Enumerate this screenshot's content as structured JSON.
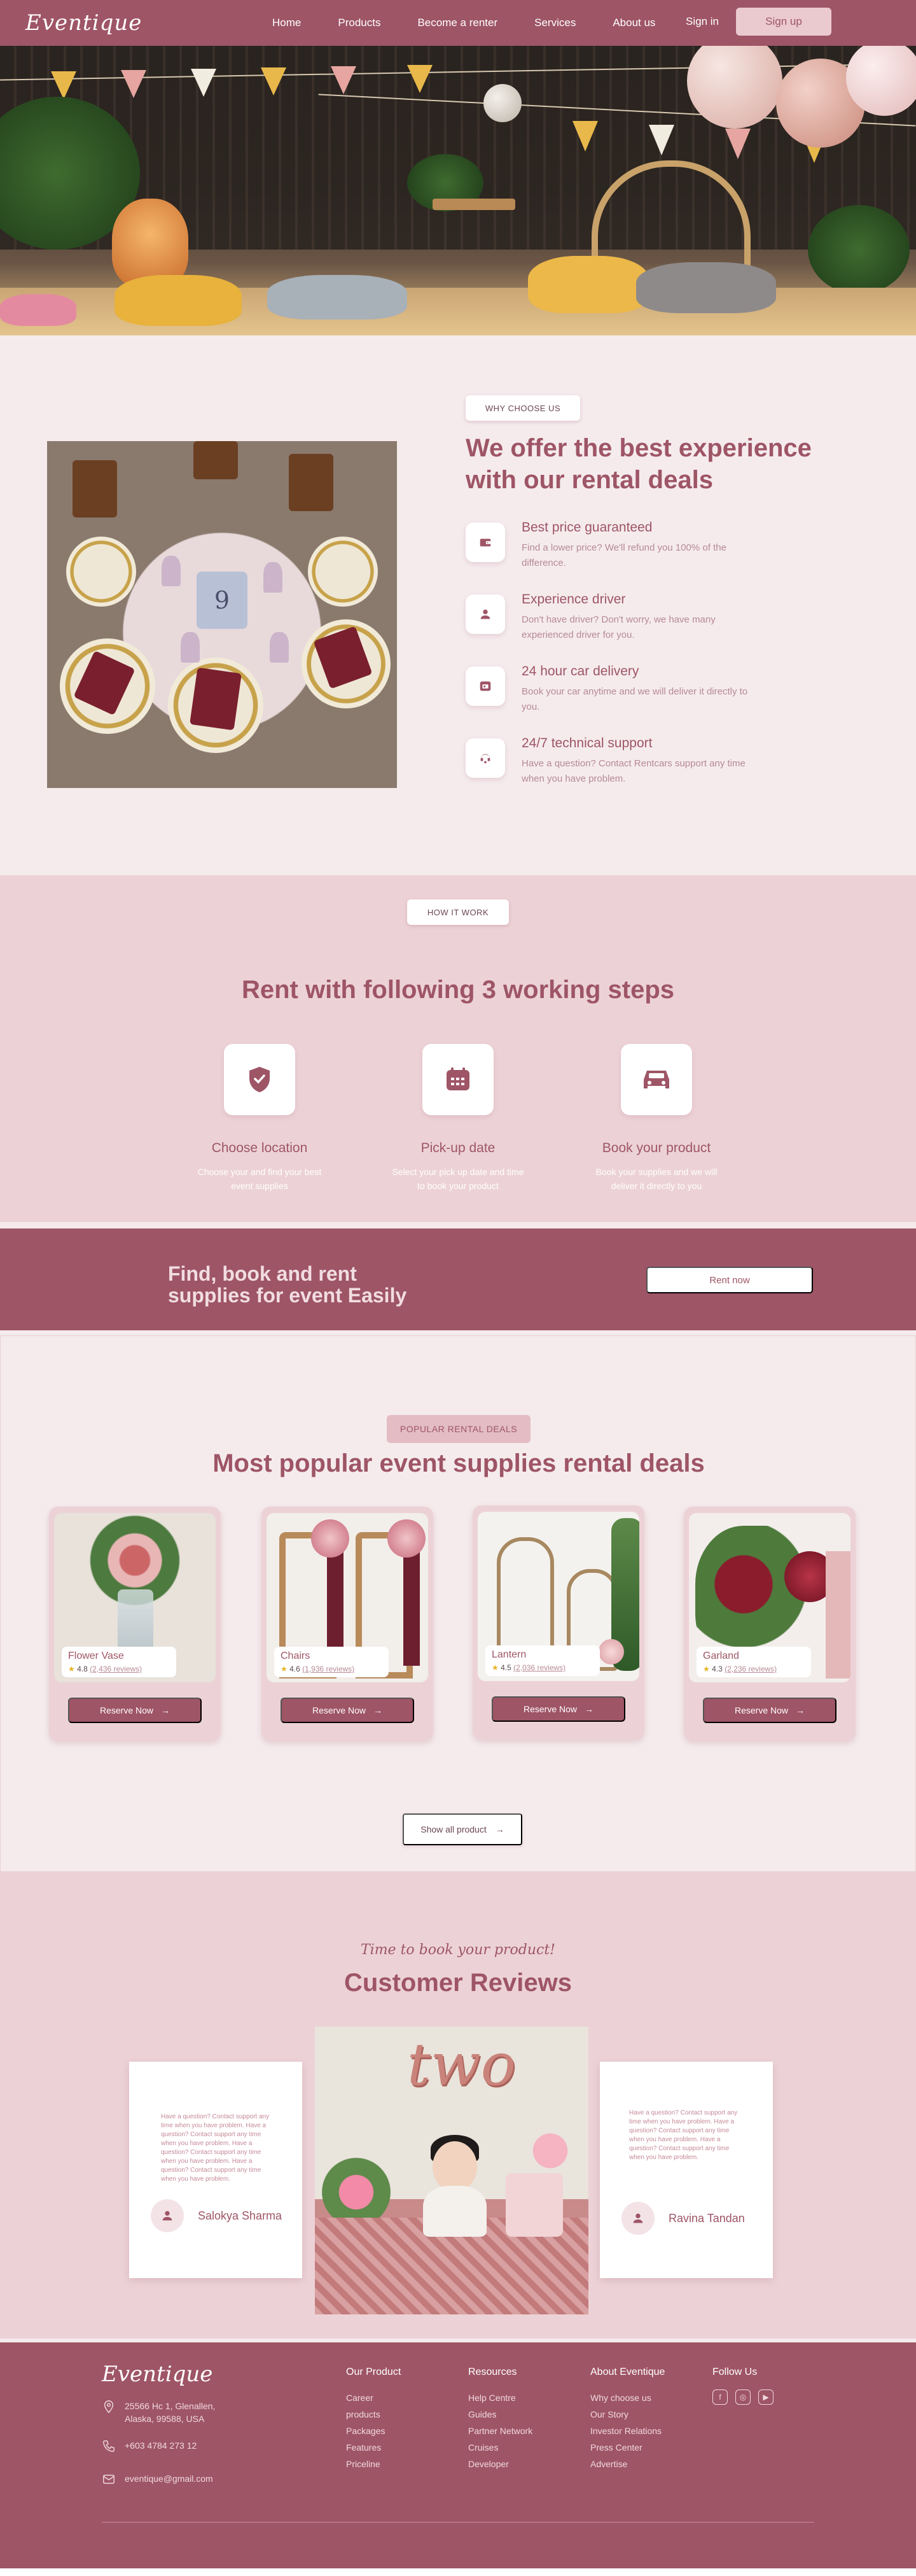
{
  "brand": {
    "logo": "Eventique"
  },
  "nav": {
    "links": [
      "Home",
      "Products",
      "Become a renter",
      "Services",
      "About us"
    ],
    "signin": "Sign in",
    "signup": "Sign up"
  },
  "why": {
    "tag": "WHY CHOOSE US",
    "title": "We offer the best experience with our rental deals",
    "photo_number": "9",
    "features": [
      {
        "title": "Best price guaranteed",
        "text": "Find a lower price? We'll refund you 100% of the difference.",
        "icon": "wallet-icon"
      },
      {
        "title": "Experience driver",
        "text": "Don't have driver? Don't worry, we have many experienced driver for you.",
        "icon": "person-icon"
      },
      {
        "title": "24 hour car delivery",
        "text": "Book your car anytime and we will deliver it directly to you.",
        "icon": "calendar-icon"
      },
      {
        "title": "24/7 technical support",
        "text": "Have a question? Contact Rentcars support any time when you have problem.",
        "icon": "headset-icon"
      }
    ]
  },
  "how": {
    "tag": "HOW IT WORK",
    "title": "Rent with following 3 working steps",
    "steps": [
      {
        "title": "Choose location",
        "text": "Choose your and find your best event supplies",
        "icon": "location-shield-icon"
      },
      {
        "title": "Pick-up date",
        "text": "Select your pick up date and time to book your product",
        "icon": "calendar-icon"
      },
      {
        "title": "Book your product",
        "text": "Book your supplies and we will deliver it directly to you",
        "icon": "car-icon"
      }
    ]
  },
  "cta": {
    "title": "Find, book and rent supplies for event Easily",
    "button": "Rent now"
  },
  "popular": {
    "tag": "POPULAR RENTAL DEALS",
    "title": "Most popular event supplies rental deals",
    "items": [
      {
        "name": "Flower Vase",
        "rating": "4.8",
        "reviews": "(2,436 reviews)",
        "button": "Reserve Now"
      },
      {
        "name": "Chairs",
        "rating": "4.6",
        "reviews": "(1,936 reviews)",
        "button": "Reserve Now"
      },
      {
        "name": "Lantern",
        "rating": "4.5",
        "reviews": "(2,036 reviews)",
        "button": "Reserve Now"
      },
      {
        "name": "Garland",
        "rating": "4.3",
        "reviews": "(2,236 reviews)",
        "button": "Reserve Now"
      }
    ],
    "show_all": "Show all product"
  },
  "reviews": {
    "subtitle": "Time to book your product!",
    "title": "Customer Reviews",
    "photo_text": "two",
    "cards": [
      {
        "text": "Have a question? Contact support any time when you have problem. Have a question? Contact support any time when you have problem. Have a question? Contact support any time when you have problem. Have a question? Contact support any time when you have problem.",
        "name": "Salokya Sharma"
      },
      {
        "text": "Have a question? Contact support any time when you have problem. Have a question? Contact support any time when you have problem. Have a question? Contact support any time when you have problem.",
        "name": "Ravina Tandan"
      }
    ]
  },
  "footer": {
    "logo": "Eventique",
    "address": "25566 Hc 1, Glenallen, Alaska, 99588, USA",
    "phone": "+603 4784 273 12",
    "email": "eventique@gmail.com",
    "columns": [
      {
        "title": "Our Product",
        "links": [
          "Career",
          "products",
          "Packages",
          "Features",
          "Priceline"
        ]
      },
      {
        "title": "Resources",
        "links": [
          "Help Centre",
          "Guides",
          "Partner Network",
          "Cruises",
          "Developer"
        ]
      },
      {
        "title": "About Eventique",
        "links": [
          "Why choose us",
          "Our Story",
          "Investor Relations",
          "Press Center",
          "Advertise"
        ]
      }
    ],
    "follow_title": "Follow Us",
    "social": [
      "facebook-icon",
      "instagram-icon",
      "youtube-icon"
    ]
  },
  "colors": {
    "primary": "#9e5566",
    "light": "#ecd2d7",
    "background": "#f5ebed",
    "accent": "#eac9cf"
  }
}
